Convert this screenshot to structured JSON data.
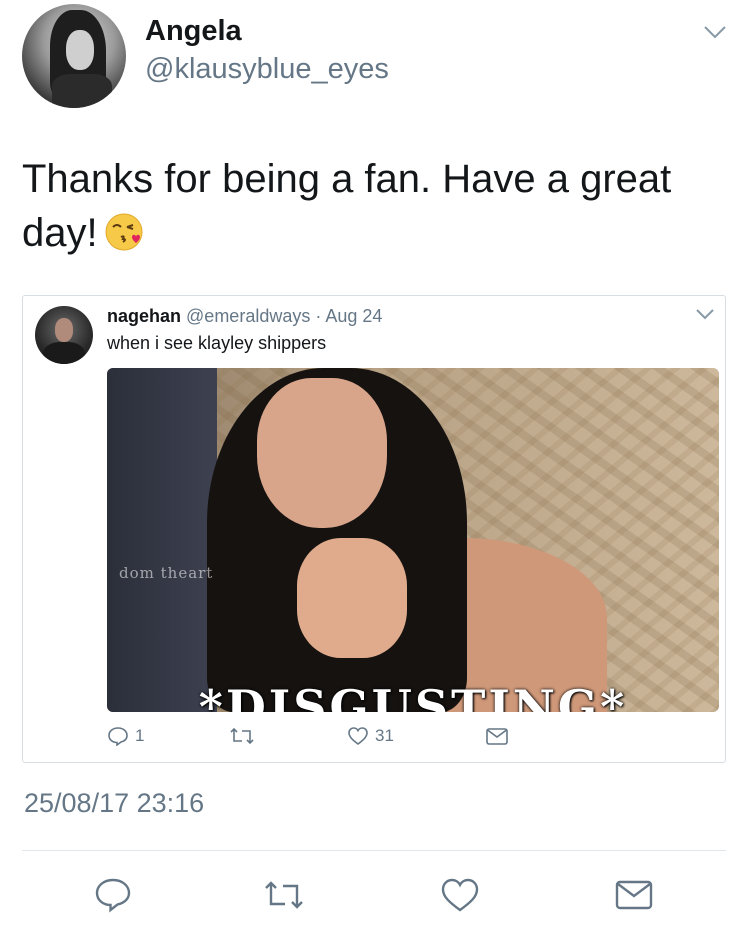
{
  "tweet": {
    "author_name": "Angela",
    "author_handle": "@klausyblue_eyes",
    "text": "Thanks for being a fan. Have a great day!",
    "emoji_icon": "face-blowing-kiss-icon",
    "timestamp": "25/08/17 23:16"
  },
  "quoted_tweet": {
    "author_name": "nagehan",
    "author_handle": "@emeraldways",
    "separator": " · ",
    "date": "Aug 24",
    "text": "when i see klayley shippers",
    "media": {
      "watermark": "dom theart",
      "caption": "*DISGUSTING*"
    },
    "actions": {
      "reply_count": "1",
      "retweet_count": "",
      "like_count": "31"
    }
  },
  "actions": [
    "reply-icon",
    "retweet-icon",
    "like-icon",
    "message-icon"
  ],
  "colors": {
    "text_primary": "#14171a",
    "text_secondary": "#657786",
    "icon": "#657786",
    "border": "#d7dee3"
  }
}
